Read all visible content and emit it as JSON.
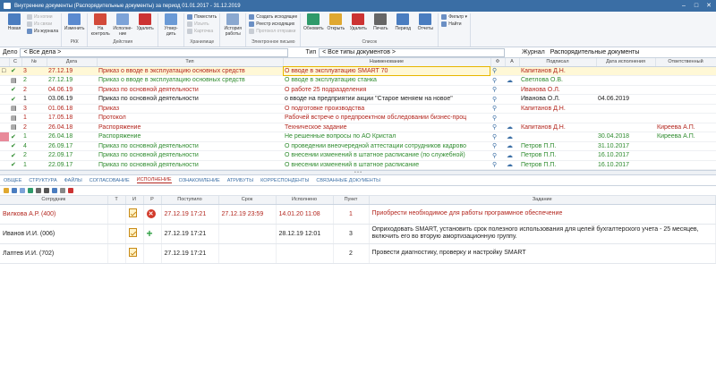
{
  "window": {
    "title": "Внутренние документы (Распорядительные документы) за период 01.01.2017 - 31.12.2019",
    "min": "–",
    "max": "□",
    "close": "✕"
  },
  "ribbon": {
    "groups": [
      {
        "label": "",
        "big": [
          {
            "label": "Новая",
            "icon": "new-doc-icon",
            "color": "#4a7dc0"
          }
        ],
        "small": [
          {
            "label": "Из копии",
            "dis": true
          },
          {
            "label": "Из связи",
            "dis": true
          },
          {
            "label": "Из журнала",
            "dis": false
          }
        ]
      },
      {
        "label": "РКК",
        "big": [
          {
            "label": "Изменить",
            "icon": "edit-icon",
            "color": "#5a8ad0"
          }
        ],
        "small": []
      },
      {
        "label": "Действия",
        "big": [
          {
            "label": "На контроль",
            "icon": "control-icon",
            "color": "#d24a3a"
          },
          {
            "label": "Исполне-ние",
            "icon": "execution-icon",
            "color": "#7ca3d8"
          },
          {
            "label": "Удалить",
            "icon": "delete-icon",
            "color": "#c33"
          }
        ],
        "small": []
      },
      {
        "label": "",
        "big": [
          {
            "label": "Утвер-дить",
            "icon": "approve-icon",
            "color": "#6a9ad6"
          }
        ],
        "small": []
      },
      {
        "label": "Хранилище",
        "big": [],
        "small": [
          {
            "label": "Поместить",
            "dis": false
          },
          {
            "label": "Изъять",
            "dis": true
          },
          {
            "label": "Карточка",
            "dis": true
          }
        ]
      },
      {
        "label": "",
        "big": [
          {
            "label": "История работы",
            "icon": "history-icon",
            "color": "#8aa8d0"
          }
        ],
        "small": []
      },
      {
        "label": "Электронное письмо",
        "big": [],
        "small": [
          {
            "label": "Создать исходящее",
            "dis": false
          },
          {
            "label": "Реестр исходящих",
            "dis": false
          },
          {
            "label": "Протокол отправки",
            "dis": true
          }
        ]
      },
      {
        "label": "Список",
        "big": [
          {
            "label": "Обновить",
            "icon": "refresh-icon",
            "color": "#2e9a6a"
          },
          {
            "label": "Открыть",
            "icon": "open-icon",
            "color": "#e0a830"
          },
          {
            "label": "Удалить",
            "icon": "remove-icon",
            "color": "#c33"
          },
          {
            "label": "Печать",
            "icon": "print-icon",
            "color": "#666"
          },
          {
            "label": "Период",
            "icon": "period-icon",
            "color": "#4a7dc0"
          },
          {
            "label": "Отчеты",
            "icon": "reports-icon",
            "color": "#4a7dc0"
          }
        ],
        "small": []
      },
      {
        "label": "",
        "big": [],
        "small": [
          {
            "label": "Фильтр ▾",
            "dis": false
          },
          {
            "label": "Найти",
            "dis": false
          }
        ]
      }
    ]
  },
  "filter": {
    "delo_label": "Дело",
    "delo_value": "< Все дела >",
    "type_label": "Тип",
    "type_value": "< Все типы документов >",
    "journal_label": "Журнал",
    "journal_value": "Распорядительные документы"
  },
  "grid": {
    "headers": [
      "",
      "С",
      "№",
      "Дата",
      "Тип",
      "Наименование",
      "Ф",
      "А",
      "Подписал",
      "Дата исполнения",
      "Ответственный"
    ],
    "rows": [
      {
        "mark": "□",
        "st": "✔",
        "num": "3",
        "date": "27.12.19",
        "type": "Приказ о вводе в эксплуатацию основных средств",
        "name": "О вводе в эксплуатацию SMART 70",
        "clip": true,
        "cloud": false,
        "signer": "Капитанов Д.Н.",
        "exec": "",
        "resp": "",
        "color": "red",
        "sel": true
      },
      {
        "mark": "",
        "st": "▤",
        "num": "2",
        "date": "27.12.19",
        "type": "Приказ о вводе в эксплуатацию основных средств",
        "name": "О вводе в эксплуатацию станка",
        "clip": true,
        "cloud": true,
        "signer": "Светлова О.В.",
        "exec": "",
        "resp": "",
        "color": "green",
        "sel": false
      },
      {
        "mark": "",
        "st": "✔",
        "num": "2",
        "date": "04.06.19",
        "type": "Приказ по основной деятельности",
        "name": "О работе 25 подразделения",
        "clip": true,
        "cloud": false,
        "signer": "Иванова О.Л.",
        "exec": "",
        "resp": "",
        "color": "red",
        "sel": false
      },
      {
        "mark": "",
        "st": "✔",
        "num": "1",
        "date": "03.06.19",
        "type": "Приказ по основной деятельности",
        "name": "о вводе на предприятии акции \"Старое меняем на новое\"",
        "clip": true,
        "cloud": false,
        "signer": "Иванова О.Л.",
        "exec": "04.06.2019",
        "resp": "",
        "color": "blk",
        "sel": false
      },
      {
        "mark": "",
        "st": "▤",
        "num": "3",
        "date": "01.06.18",
        "type": "Приказ",
        "name": "О подготовке производства",
        "clip": true,
        "cloud": false,
        "signer": "Капитанов Д.Н.",
        "exec": "",
        "resp": "",
        "color": "red",
        "sel": false
      },
      {
        "mark": "",
        "st": "▤",
        "num": "1",
        "date": "17.05.18",
        "type": "Протокол",
        "name": "Рабочей встрече о предпроектном обследовании бизнес-проц",
        "clip": true,
        "cloud": false,
        "signer": "",
        "exec": "",
        "resp": "",
        "color": "red",
        "sel": false
      },
      {
        "mark": "",
        "st": "▤",
        "num": "2",
        "date": "26.04.18",
        "type": "Распоряжение",
        "name": "Техническое задание",
        "clip": true,
        "cloud": true,
        "signer": "Капитанов Д.Н.",
        "exec": "",
        "resp": "Киреева А.П.",
        "color": "red",
        "sel": false
      },
      {
        "mark": "■",
        "st": "✔",
        "num": "1",
        "date": "26.04.18",
        "type": "Распоряжение",
        "name": "Не решенные вопросы по АО Кристал",
        "clip": true,
        "cloud": true,
        "signer": "",
        "exec": "30.04.2018",
        "resp": "Киреева А.П.",
        "color": "green",
        "sel": false
      },
      {
        "mark": "",
        "st": "✔",
        "num": "4",
        "date": "26.09.17",
        "type": "Приказ по основной деятельности",
        "name": "О проведении внеочередной аттестации сотрудников кадрово",
        "clip": true,
        "cloud": true,
        "signer": "Петров П.П.",
        "exec": "31.10.2017",
        "resp": "",
        "color": "green",
        "sel": false
      },
      {
        "mark": "",
        "st": "✔",
        "num": "2",
        "date": "22.09.17",
        "type": "Приказ по основной деятельности",
        "name": "О внесении изменений в штатное расписание (по служебной)",
        "clip": true,
        "cloud": true,
        "signer": "Петров П.П.",
        "exec": "16.10.2017",
        "resp": "",
        "color": "green",
        "sel": false
      },
      {
        "mark": "",
        "st": "✔",
        "num": "1",
        "date": "22.09.17",
        "type": "Приказ по основной деятельности",
        "name": "О внесении изменений в штатное расписание",
        "clip": true,
        "cloud": true,
        "signer": "Петров П.П.",
        "exec": "16.10.2017",
        "resp": "",
        "color": "green",
        "sel": false
      }
    ]
  },
  "tabs": [
    "ОБЩЕЕ",
    "СТРУКТУРА",
    "ФАЙЛЫ",
    "СОГЛАСОВАНИЕ",
    "ИСПОЛНЕНИЕ",
    "ОЗНАКОМЛЕНИЕ",
    "АТРИБУТЫ",
    "КОРРЕСПОНДЕНТЫ",
    "СВЯЗАННЫЕ ДОКУМЕНТЫ"
  ],
  "active_tab": "ИСПОЛНЕНИЕ",
  "detail": {
    "headers": [
      "Сотрудник",
      "Т",
      "И",
      "Р",
      "Поступило",
      "Срок",
      "Исполнено",
      "Пункт",
      "Задание"
    ],
    "rows": [
      {
        "emp": "Вилкова А.Р. (400)",
        "status": "x",
        "received": "27.12.19 17:21",
        "due": "27.12.19 23:59",
        "done": "14.01.20 11:08",
        "item": "1",
        "task": "Приобрести необходимое для работы программное обеспечение",
        "color": "red"
      },
      {
        "emp": "Иванов И.И. (006)",
        "status": "+",
        "received": "27.12.19 17:21",
        "due": "",
        "done": "28.12.19 12:01",
        "item": "3",
        "task": "Оприходовать SMART, установить срок полезного использования для целей бухгалтерского учета - 25 месяцев, включить его во вторую амортизационную группу.",
        "color": "blk"
      },
      {
        "emp": "Лаптев И.И. (702)",
        "status": "",
        "received": "27.12.19 17:21",
        "due": "",
        "done": "",
        "item": "2",
        "task": "Провести диагностику, проверку и настройку SMART",
        "color": "blk"
      }
    ]
  }
}
